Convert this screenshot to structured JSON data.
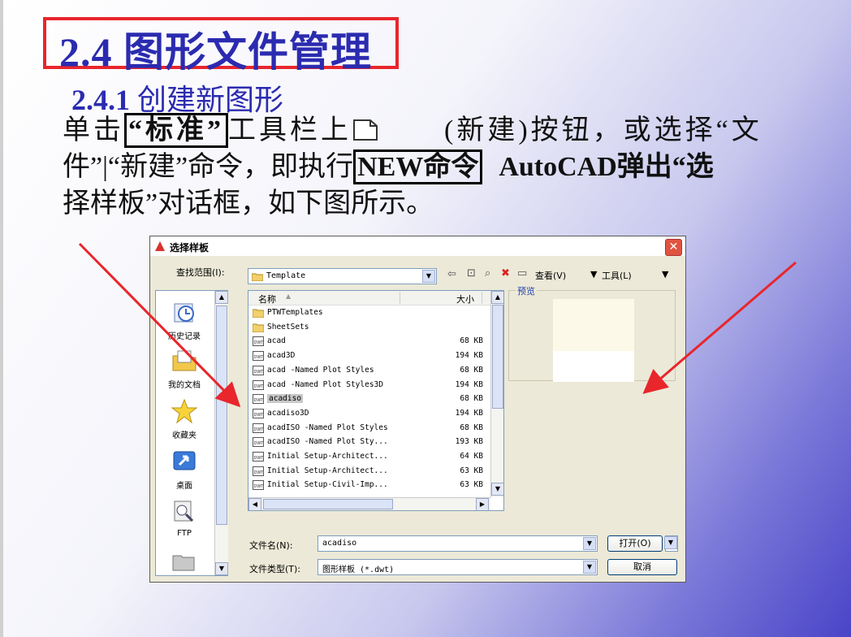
{
  "slide": {
    "title": "2.4  图形文件管理",
    "subtitle_num": "2.4.1",
    "subtitle_text": " 创建新图形",
    "para": {
      "l1_a": "单击",
      "l1_boxed": "“标准”",
      "l1_b": "工具栏上",
      "l1_c": "(新建)按钮，或选择“文",
      "l2_a": "件”|“新建”命令，即执行",
      "l2_boxed": "NEW命令",
      "l2_b": "AutoCAD弹出“选",
      "l3": "择样板”对话框，如下图所示。"
    }
  },
  "dialog": {
    "title": "选择样板",
    "close": "✕",
    "lookin_label": "查找范围(I):",
    "lookin_value": "Template",
    "view_label": "查看(V)",
    "tools_label": "工具(L)",
    "places": [
      "历史记录",
      "我的文档",
      "收藏夹",
      "桌面",
      "FTP"
    ],
    "col_name": "名称",
    "col_size": "大小",
    "files": [
      {
        "name": "PTWTemplates",
        "size": "",
        "type": "folder"
      },
      {
        "name": "SheetSets",
        "size": "",
        "type": "folder"
      },
      {
        "name": "acad",
        "size": "68 KB",
        "type": "dwt"
      },
      {
        "name": "acad3D",
        "size": "194 KB",
        "type": "dwt"
      },
      {
        "name": "acad -Named Plot Styles",
        "size": "68 KB",
        "type": "dwt"
      },
      {
        "name": "acad -Named Plot Styles3D",
        "size": "194 KB",
        "type": "dwt"
      },
      {
        "name": "acadiso",
        "size": "68 KB",
        "type": "dwt",
        "selected": true
      },
      {
        "name": "acadiso3D",
        "size": "194 KB",
        "type": "dwt"
      },
      {
        "name": "acadISO -Named Plot Styles",
        "size": "68 KB",
        "type": "dwt"
      },
      {
        "name": "acadISO -Named Plot Sty...",
        "size": "193 KB",
        "type": "dwt"
      },
      {
        "name": "Initial Setup-Architect...",
        "size": "64 KB",
        "type": "dwt"
      },
      {
        "name": "Initial Setup-Architect...",
        "size": "63 KB",
        "type": "dwt"
      },
      {
        "name": "Initial Setup-Civil-Imp...",
        "size": "63 KB",
        "type": "dwt"
      }
    ],
    "preview_label": "预览",
    "filename_label": "文件名(N):",
    "filename_value": "acadiso",
    "filetype_label": "文件类型(T):",
    "filetype_value": "图形样板 (*.dwt)",
    "open_button": "打开(O)",
    "cancel_button": "取消"
  },
  "colors": {
    "title_blue": "#2b2bb0",
    "title_box_red": "#e8262c",
    "arrow_red": "#e8262c"
  }
}
